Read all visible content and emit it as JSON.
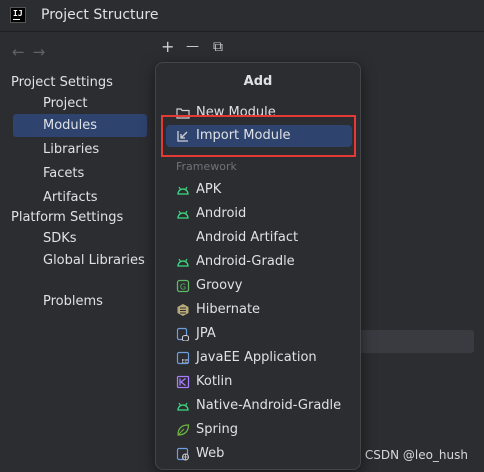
{
  "window": {
    "title": "Project Structure",
    "app_icon_text": "IJ"
  },
  "nav": {
    "back": "←",
    "forward": "→"
  },
  "sidebar": {
    "project_settings": "Project Settings",
    "project_items": [
      {
        "label": "Project"
      },
      {
        "label": "Modules",
        "selected": true
      },
      {
        "label": "Libraries"
      },
      {
        "label": "Facets"
      },
      {
        "label": "Artifacts"
      }
    ],
    "platform_settings": "Platform Settings",
    "platform_items": [
      {
        "label": "SDKs"
      },
      {
        "label": "Global Libraries"
      }
    ],
    "problems": "Problems"
  },
  "toolbar": {
    "add": "+",
    "remove": "—",
    "copy": "⧉"
  },
  "popup": {
    "title": "Add",
    "items": [
      {
        "label": "New Module",
        "icon": "folder-icon"
      },
      {
        "label": "Import Module",
        "icon": "import-icon",
        "selected": true
      }
    ],
    "framework_label": "Framework",
    "framework_items": [
      {
        "label": "APK",
        "icon": "android-icon"
      },
      {
        "label": "Android",
        "icon": "android-icon"
      },
      {
        "label": "Android Artifact",
        "icon": ""
      },
      {
        "label": "Android-Gradle",
        "icon": "android-icon"
      },
      {
        "label": "Groovy",
        "icon": "groovy-icon"
      },
      {
        "label": "Hibernate",
        "icon": "hibernate-icon"
      },
      {
        "label": "JPA",
        "icon": "jpa-icon"
      },
      {
        "label": "JavaEE Application",
        "icon": "javaee-icon"
      },
      {
        "label": "Kotlin",
        "icon": "kotlin-icon"
      },
      {
        "label": "Native-Android-Gradle",
        "icon": "android-icon"
      },
      {
        "label": "Spring",
        "icon": "spring-icon"
      },
      {
        "label": "Web",
        "icon": "web-icon"
      }
    ]
  },
  "watermark": "CSDN @leo_hush",
  "colors": {
    "accent_selected": "#2e436e",
    "highlight_box": "#e53935",
    "android_green": "#3ddc84"
  }
}
